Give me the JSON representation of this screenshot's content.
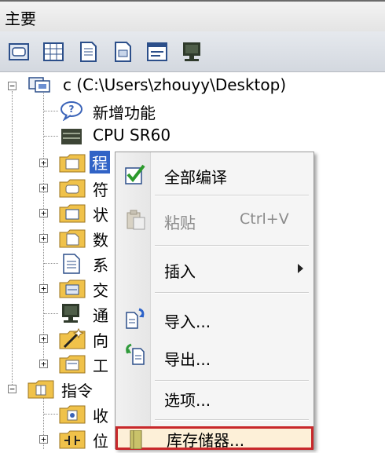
{
  "window": {
    "title": "主要"
  },
  "toolbar": {
    "buttons": [
      {
        "icon": "view-icon"
      },
      {
        "icon": "grid-icon"
      },
      {
        "icon": "document-icon"
      },
      {
        "icon": "page-icon"
      },
      {
        "icon": "form-icon"
      },
      {
        "icon": "monitor-icon"
      }
    ]
  },
  "tree": {
    "root": {
      "label": "c (C:\\Users\\zhouyy\\Desktop)"
    },
    "items": [
      {
        "label": "新增功能",
        "icon": "help-icon"
      },
      {
        "label": "CPU SR60",
        "icon": "cpu-icon"
      },
      {
        "label": "程",
        "icon": "folder-icon",
        "selected": true
      },
      {
        "label": "符",
        "icon": "folder-icon"
      },
      {
        "label": "状",
        "icon": "folder-icon"
      },
      {
        "label": "数",
        "icon": "folder-icon"
      },
      {
        "label": "系",
        "icon": "document-icon"
      },
      {
        "label": "交",
        "icon": "folder-icon"
      },
      {
        "label": "通",
        "icon": "monitor-icon"
      },
      {
        "label": "向",
        "icon": "wizard-icon"
      },
      {
        "label": "工",
        "icon": "folder-icon"
      }
    ],
    "instructions": {
      "label": "指令"
    },
    "instruction_items": [
      {
        "label": "收",
        "icon": "folder-icon"
      },
      {
        "label": "位",
        "icon": "folder-icon"
      }
    ]
  },
  "context_menu": {
    "items": [
      {
        "label": "全部编译",
        "icon": "check-icon"
      },
      {
        "label": "粘贴",
        "shortcut": "Ctrl+V",
        "disabled": true,
        "icon": "paste-icon"
      },
      {
        "label": "插入",
        "submenu": true
      },
      {
        "label": "导入...",
        "icon": "import-icon"
      },
      {
        "label": "导出...",
        "icon": "export-icon"
      },
      {
        "label": "选项..."
      },
      {
        "label": "库存储器...",
        "icon": "library-icon",
        "highlighted": true
      }
    ]
  },
  "colors": {
    "selection": "#3163c6",
    "highlight_border": "#c8282b",
    "menu_background": "#f5f5f5"
  }
}
